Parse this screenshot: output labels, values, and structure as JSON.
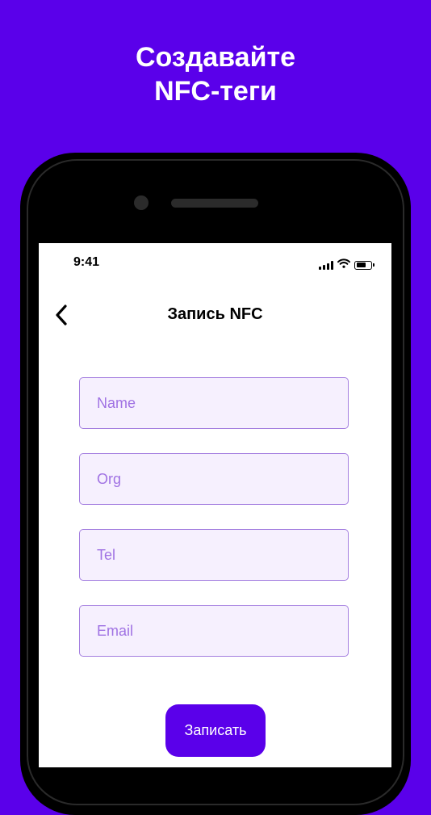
{
  "promo": {
    "headline_line1": "Создавайте",
    "headline_line2": "NFC-теги"
  },
  "colors": {
    "background": "#5a00ea",
    "accent": "#5a00ea",
    "field_border": "#a580e0",
    "field_fill": "#f6f0fe",
    "placeholder": "#a072e3"
  },
  "status_bar": {
    "time": "9:41",
    "icons": [
      "signal-icon",
      "wifi-icon",
      "battery-icon"
    ]
  },
  "nav": {
    "back_icon": "chevron-left-icon",
    "title": "Запись NFC"
  },
  "form": {
    "fields": [
      {
        "placeholder": "Name",
        "value": ""
      },
      {
        "placeholder": "Org",
        "value": ""
      },
      {
        "placeholder": "Tel",
        "value": ""
      },
      {
        "placeholder": "Email",
        "value": ""
      }
    ],
    "submit_label": "Записать"
  }
}
